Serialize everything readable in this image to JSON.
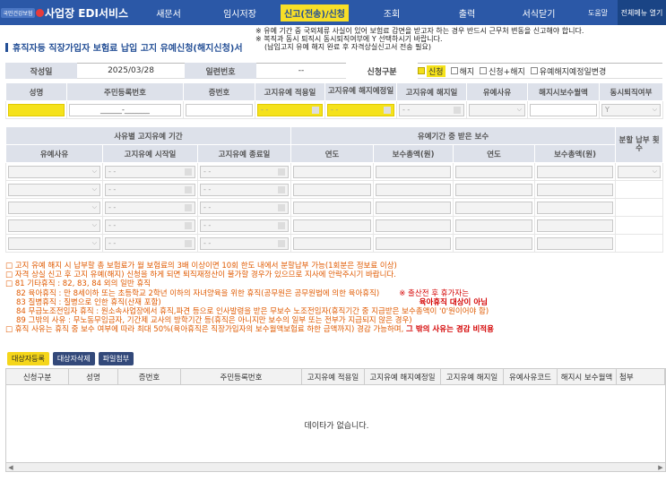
{
  "header": {
    "logo": "국민건강보험",
    "app_title": "사업장 EDI서비스",
    "menu": [
      "새문서",
      "임시저장",
      "신고(전송)/신청",
      "조회",
      "출력",
      "서식닫기"
    ],
    "help": "도움말",
    "all_menu": "전체메뉴 열기"
  },
  "page": {
    "title": "휴직자등 직장가입자 보험료 납입 고지 유예신청(해지신청)서"
  },
  "notice": [
    "※ 유예 기간 중 국외체류 사실이 있어 보험료 감면을 받고자 하는 경우 반드시 근무처 변동을 신고해야 합니다.",
    "※ 복직과 동시 퇴직시 동시퇴직여부에 Y 선택하시기 바랍니다.",
    "(납입고지 유예 해지 완료 후 자격상실신고서 전송 필요)"
  ],
  "form": {
    "date_label": "작성일",
    "date_value": "2025/03/28",
    "serial_label": "일련번호",
    "serial_value": "--",
    "apply_label": "신청구분",
    "opt_apply": "신청",
    "opt_cancel": "해지",
    "opt_apply_cancel": "신청+해지",
    "opt_change": "유예해지예정일변경"
  },
  "emp_headers": [
    "성명",
    "주민등록번호",
    "증번호",
    "고지유예 적용일",
    "고지유예 해지예정일",
    "고지유예 해지일",
    "유예사유",
    "해지시보수월액",
    "동시퇴직여부"
  ],
  "emp_row": {
    "rrn": "______-_______",
    "date_ph": "- -",
    "select_val": "Y"
  },
  "period": {
    "group1": "사유별 고지유예 기간",
    "group2": "유예기간 중 받은 보수",
    "install": "분할 납부 횟수",
    "cols": [
      "유예사유",
      "고지유예 시작일",
      "고지유예 종료일",
      "연도",
      "보수총액(원)",
      "연도",
      "보수총액(원)"
    ],
    "date_ph": "- -"
  },
  "notes": [
    "□ 고지 유예 해지 시 납부할 총 보험료가 월 보험료의 3배 이상이면 10회 한도 내에서 분할납부 가능(1회분은 정보료 이상)",
    "□ 자격 상실 신고 후 고지 유예(해지) 신청을 하게 되면 퇴직재정산이 불가할 경우가 있으므로 지사에 안락주시기 바랍니다.",
    "□ 81 기타휴직 : 82, 83, 84 외의 일반 휴직",
    "82 육아휴직 : 만 8세이하 또는 초등학교 2학년 이하의 자녀양육을 위한 휴직(공무원은 공무원법에 의한 육아휴직)",
    "83 질병휴직 : 질병으로 인한 휴직(산재 포함)",
    "84 무급노조전임자 휴직 : 원소속사업장에서 휴직,파견 등으로 인사발령을 받은 무보수 노조전임자(휴직기간 중 지급받은 보수총액이 '0'원이어야 함)",
    "89 그밖의 사유 : 무노동무임금자, 기간제 교사의 방학기간 등(휴직은 아니지만 보수의 일부 또는 전부가 지급되지 않은 경우)",
    "□ 휴직 사유는 휴직 중 보수 여부에 따라 최대 50%(육아휴직은 직장가입자의 보수월액보험료 하한 금액까지) 경감 가능하며,"
  ],
  "note_red": "그 밖의 사유는 경감 비적용",
  "side_note1": "※ 출산전 후 휴가자는",
  "side_note2": "육아휴직 대상이 아님",
  "buttons": {
    "add": "대상자등록",
    "delete": "대상자삭제",
    "attach": "파일첨부"
  },
  "grid": {
    "headers": [
      "신청구분",
      "성명",
      "증번호",
      "주민등록번호",
      "고지유예 적용일",
      "고지유예 해지예정일",
      "고지유예 해지일",
      "유예사유코드",
      "해지시 보수월액",
      "첨부"
    ],
    "empty": "데이타가 없습니다."
  },
  "colors": {
    "header_bg": "#2b58a7",
    "highlight": "#f5e21b",
    "label_bg": "#dde1ea",
    "note_text": "#e05a00"
  }
}
